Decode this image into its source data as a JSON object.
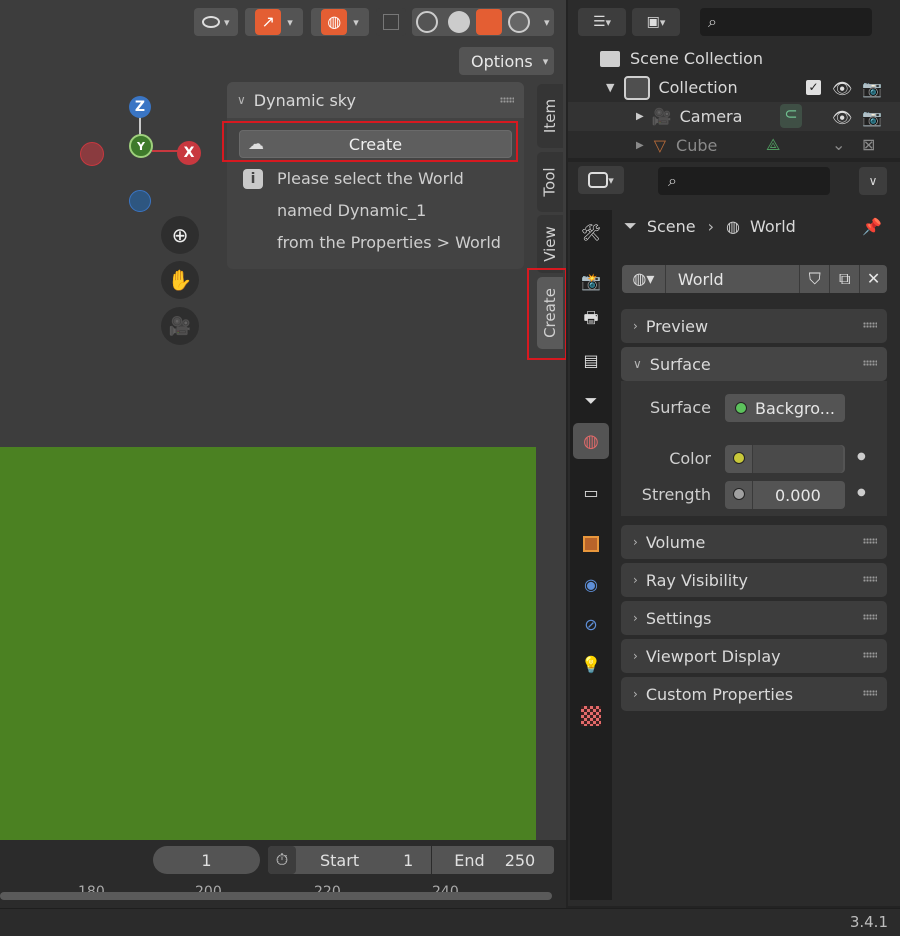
{
  "viewport": {
    "options_label": "Options",
    "gizmo": {
      "z": "Z",
      "x": "X",
      "y": "Y"
    }
  },
  "dynamic_sky": {
    "title": "Dynamic sky",
    "create_label": "Create",
    "info_lines": [
      "Please select the World",
      "named Dynamic_1",
      "from the Properties > World"
    ]
  },
  "side_tabs": [
    "Item",
    "Tool",
    "View",
    "Create"
  ],
  "timeline": {
    "current_frame": "1",
    "start_label": "Start",
    "start_value": "1",
    "end_label": "End",
    "end_value": "250",
    "ruler": [
      "180",
      "200",
      "220",
      "240"
    ]
  },
  "outliner": {
    "scene_collection": "Scene Collection",
    "collection": "Collection",
    "camera": "Camera",
    "cube": "Cube"
  },
  "properties": {
    "breadcrumb_scene": "Scene",
    "breadcrumb_world": "World",
    "world_name": "World",
    "sections": {
      "preview": "Preview",
      "surface": "Surface",
      "volume": "Volume",
      "ray_visibility": "Ray Visibility",
      "settings": "Settings",
      "viewport_display": "Viewport Display",
      "custom_properties": "Custom Properties"
    },
    "surface_label": "Surface",
    "surface_value": "Backgro...",
    "color_label": "Color",
    "strength_label": "Strength",
    "strength_value": "0.000"
  },
  "status": {
    "version": "3.4.1"
  },
  "colors": {
    "ground": "#4b8122",
    "highlight_box": "#d71920",
    "axis_x": "#c8383f",
    "axis_y": "#5c9a3a",
    "axis_z": "#3a75c4"
  }
}
